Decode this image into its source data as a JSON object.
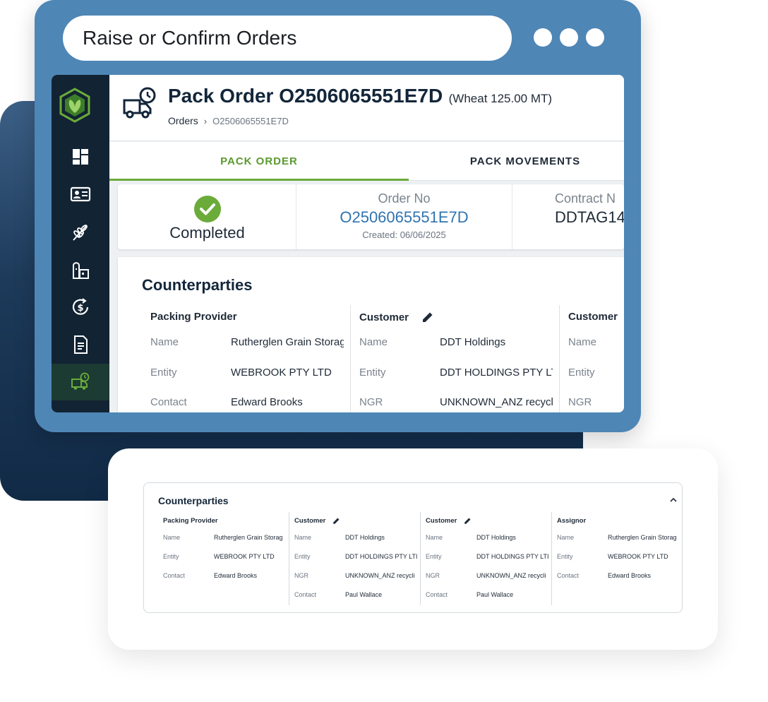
{
  "browser": {
    "url_title": "Raise or Confirm Orders"
  },
  "sidebar": {
    "items": [
      {
        "icon": "dashboard-icon"
      },
      {
        "icon": "contact-card-icon"
      },
      {
        "icon": "wheat-icon"
      },
      {
        "icon": "silo-icon"
      },
      {
        "icon": "dollar-cycle-icon"
      },
      {
        "icon": "document-icon"
      },
      {
        "icon": "truck-clock-icon",
        "active": true
      }
    ],
    "accent_color": "#6aab3a"
  },
  "header": {
    "title": "Pack Order O2506065551E7D",
    "subtitle": "(Wheat 125.00 MT)",
    "breadcrumb": {
      "parent": "Orders",
      "current": "O2506065551E7D"
    }
  },
  "tabs": [
    {
      "label": "PACK ORDER",
      "active": true
    },
    {
      "label": "PACK MOVEMENTS",
      "active": false
    }
  ],
  "summary": {
    "status": "Completed",
    "order_no_label": "Order No",
    "order_no": "O2506065551E7D",
    "created": "Created: 06/06/2025",
    "contract_label": "Contract N",
    "contract_value": "DDTAG14"
  },
  "counterparties": {
    "title": "Counterparties",
    "columns": [
      {
        "heading": "Packing Provider",
        "editable": false,
        "rows": [
          {
            "label": "Name",
            "value": "Rutherglen Grain Storag"
          },
          {
            "label": "Entity",
            "value": "WEBROOK PTY LTD"
          },
          {
            "label": "Contact",
            "value": "Edward Brooks"
          }
        ]
      },
      {
        "heading": "Customer",
        "editable": true,
        "rows": [
          {
            "label": "Name",
            "value": "DDT Holdings"
          },
          {
            "label": "Entity",
            "value": "DDT HOLDINGS PTY LTI"
          },
          {
            "label": "NGR",
            "value": "UNKNOWN_ANZ recycli"
          }
        ]
      },
      {
        "heading": "Customer",
        "editable": false,
        "rows": [
          {
            "label": "Name",
            "value": ""
          },
          {
            "label": "Entity",
            "value": ""
          },
          {
            "label": "NGR",
            "value": ""
          }
        ]
      }
    ]
  },
  "lower_counterparties": {
    "title": "Counterparties",
    "columns": [
      {
        "heading": "Packing Provider",
        "editable": false,
        "rows": [
          {
            "label": "Name",
            "value": "Rutherglen Grain Storag"
          },
          {
            "label": "Entity",
            "value": "WEBROOK PTY LTD"
          },
          {
            "label": "Contact",
            "value": "Edward Brooks"
          }
        ]
      },
      {
        "heading": "Customer",
        "editable": true,
        "rows": [
          {
            "label": "Name",
            "value": "DDT Holdings"
          },
          {
            "label": "Entity",
            "value": "DDT HOLDINGS PTY LTI"
          },
          {
            "label": "NGR",
            "value": "UNKNOWN_ANZ recycli"
          },
          {
            "label": "Contact",
            "value": "Paul Wallace"
          }
        ]
      },
      {
        "heading": "Customer",
        "editable": true,
        "rows": [
          {
            "label": "Name",
            "value": "DDT Holdings"
          },
          {
            "label": "Entity",
            "value": "DDT HOLDINGS PTY LTI"
          },
          {
            "label": "NGR",
            "value": "UNKNOWN_ANZ recycli"
          },
          {
            "label": "Contact",
            "value": "Paul Wallace"
          }
        ]
      },
      {
        "heading": "Assignor",
        "editable": false,
        "rows": [
          {
            "label": "Name",
            "value": "Rutherglen Grain Storag"
          },
          {
            "label": "Entity",
            "value": "WEBROOK PTY LTD"
          },
          {
            "label": "Contact",
            "value": "Edward Brooks"
          }
        ]
      }
    ]
  }
}
